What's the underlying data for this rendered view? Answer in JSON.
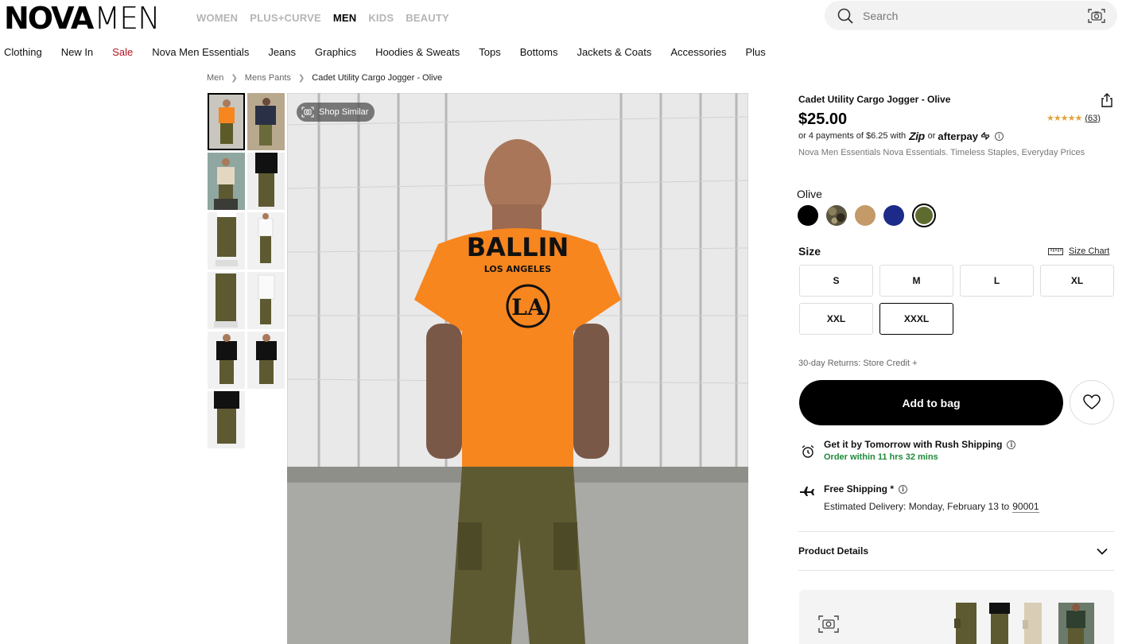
{
  "brand": {
    "part1": "NOVA",
    "part2": "MEN"
  },
  "top_nav": [
    "WOMEN",
    "PLUS+CURVE",
    "MEN",
    "KIDS",
    "BEAUTY"
  ],
  "top_nav_active": "MEN",
  "search": {
    "placeholder": "Search"
  },
  "category_nav": [
    "Clothing",
    "New In",
    "Sale",
    "Nova Men Essentials",
    "Jeans",
    "Graphics",
    "Hoodies & Sweats",
    "Tops",
    "Bottoms",
    "Jackets & Coats",
    "Accessories",
    "Plus"
  ],
  "breadcrumb": [
    "Men",
    "Mens Pants",
    "Cadet Utility Cargo Jogger - Olive"
  ],
  "gallery": {
    "shop_similar": "Shop Similar",
    "thumbnail_count": 11,
    "selected_index": 0
  },
  "product": {
    "title": "Cadet Utility Cargo Jogger - Olive",
    "price": "$25.00",
    "rating_stars": "★★★★★",
    "review_count": "(63)",
    "payments_prefix": "or 4 payments of $6.25 with",
    "zip_label": "Zip",
    "or_label": "or",
    "afterpay_label": "afterpay",
    "description": "Nova Men Essentials Nova Essentials. Timeless Staples, Everyday Prices"
  },
  "color": {
    "selected_name": "Olive",
    "swatches": [
      {
        "name": "Black",
        "hex": "#000000"
      },
      {
        "name": "Camo",
        "hex": "#5a5440"
      },
      {
        "name": "Khaki",
        "hex": "#c39a68"
      },
      {
        "name": "Navy",
        "hex": "#1c2a8a"
      },
      {
        "name": "Olive",
        "hex": "#5d6b2f"
      }
    ]
  },
  "size": {
    "label": "Size",
    "chart_label": "Size Chart",
    "options": [
      "S",
      "M",
      "L",
      "XL",
      "XXL",
      "XXXL"
    ],
    "selected": "XXXL"
  },
  "returns": "30-day Returns: Store Credit +",
  "add_to_bag": "Add to bag",
  "rush": {
    "title": "Get it by Tomorrow with Rush Shipping",
    "subtitle": "Order within 11 hrs 32 mins"
  },
  "shipping": {
    "title": "Free Shipping *",
    "estimate_prefix": "Estimated Delivery: Monday, February 13 to",
    "zip": "90001"
  },
  "product_details_label": "Product Details",
  "colors": {
    "accent_green": "#1f8a3a",
    "sale_red": "#b3121f",
    "star": "#e0a53b"
  }
}
